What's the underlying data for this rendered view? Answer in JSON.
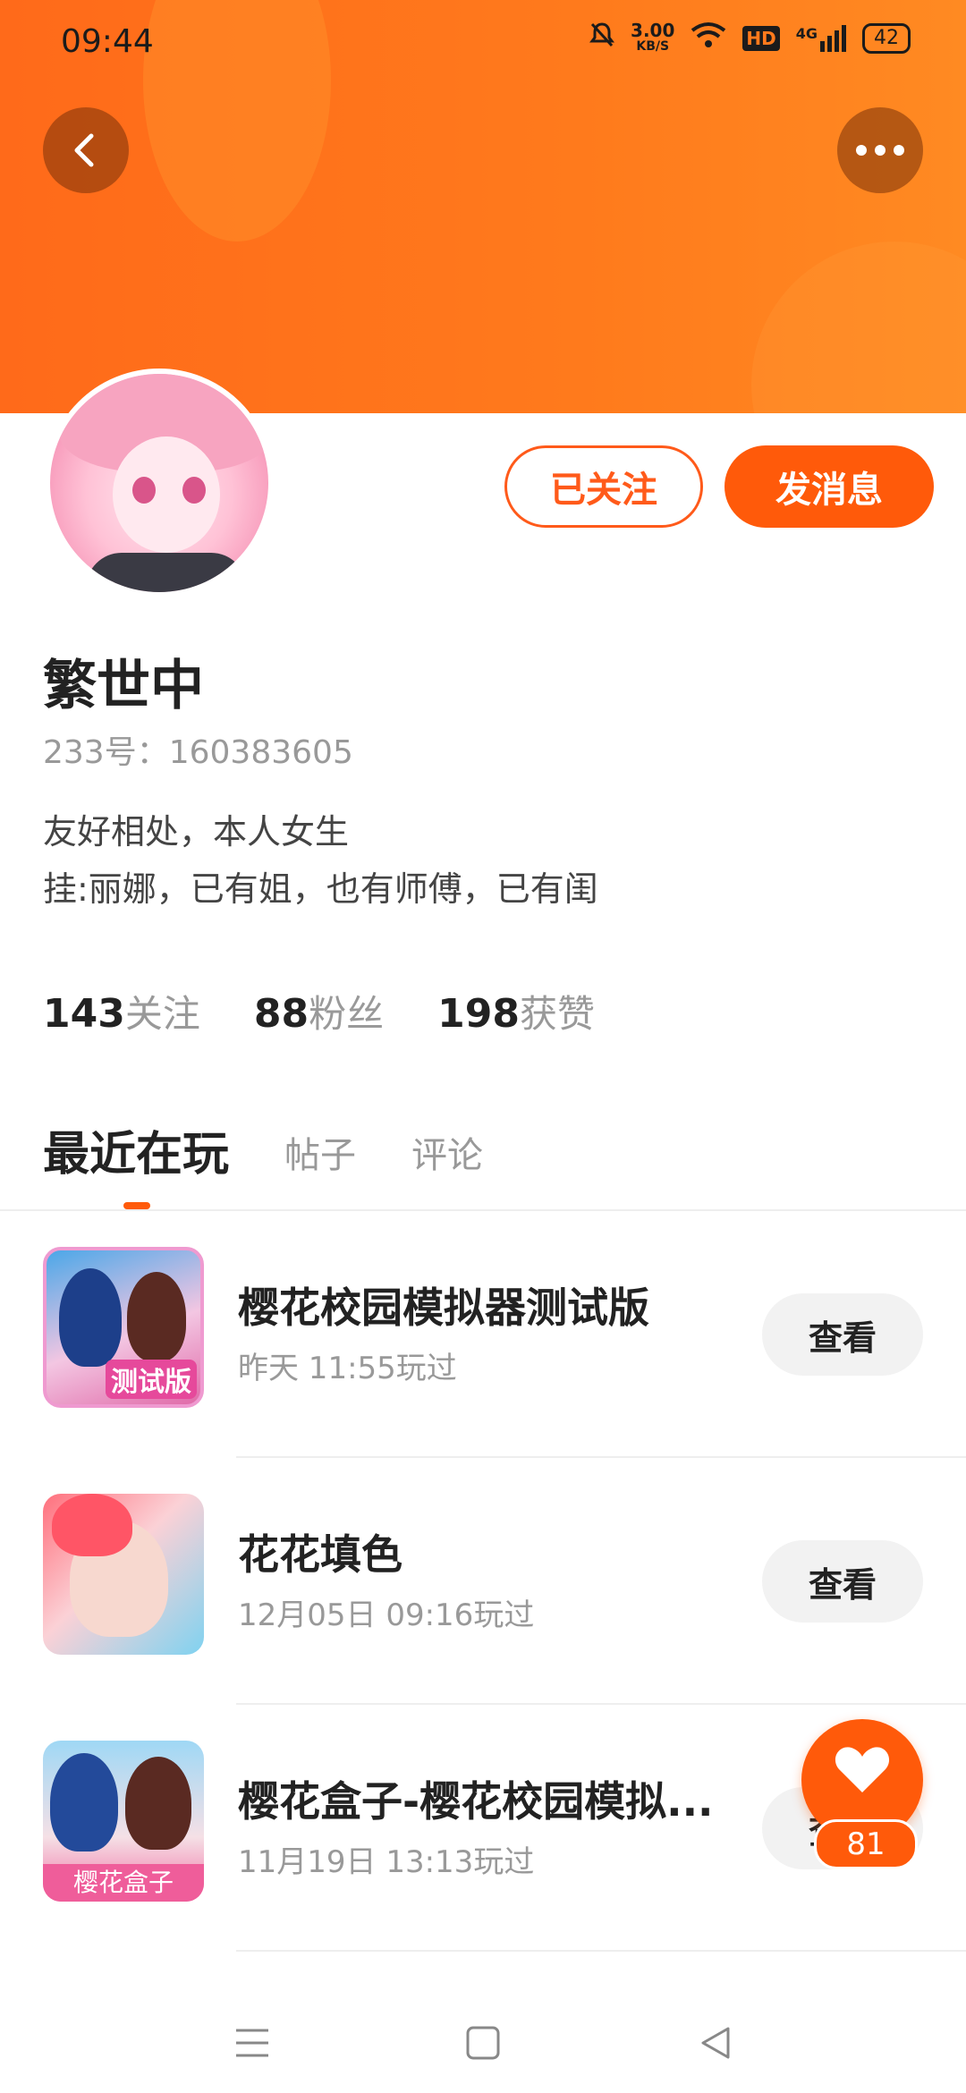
{
  "status_bar": {
    "time": "09:44",
    "speed_value": "3.00",
    "speed_unit": "KB/S",
    "hd": "HD",
    "network": "4G",
    "battery": "42"
  },
  "profile": {
    "name": "繁世中",
    "id_line": "233号：160383605",
    "bio_line1": "友好相处，本人女生",
    "bio_line2": "挂:丽娜，已有姐，也有师傅，已有闺",
    "followed_label": "已关注",
    "message_label": "发消息"
  },
  "stats": [
    {
      "value": "143",
      "label": "关注"
    },
    {
      "value": "88",
      "label": "粉丝"
    },
    {
      "value": "198",
      "label": "获赞"
    }
  ],
  "tabs": [
    {
      "label": "最近在玩",
      "active": true
    },
    {
      "label": "帖子",
      "active": false
    },
    {
      "label": "评论",
      "active": false
    }
  ],
  "games": [
    {
      "title": "樱花校园模拟器测试版",
      "time": "昨天 11:55玩过",
      "button": "查看",
      "icon_tag": "测试版"
    },
    {
      "title": "花花填色",
      "time": "12月05日 09:16玩过",
      "button": "查看"
    },
    {
      "title": "樱花盒子-樱花校园模拟...",
      "time": "11月19日 13:13玩过",
      "button": "查看",
      "icon_tag": "樱花盒子"
    }
  ],
  "like_fab": {
    "count": "81"
  },
  "colors": {
    "accent": "#ff5a0a",
    "banner": "#ff7a1c"
  }
}
